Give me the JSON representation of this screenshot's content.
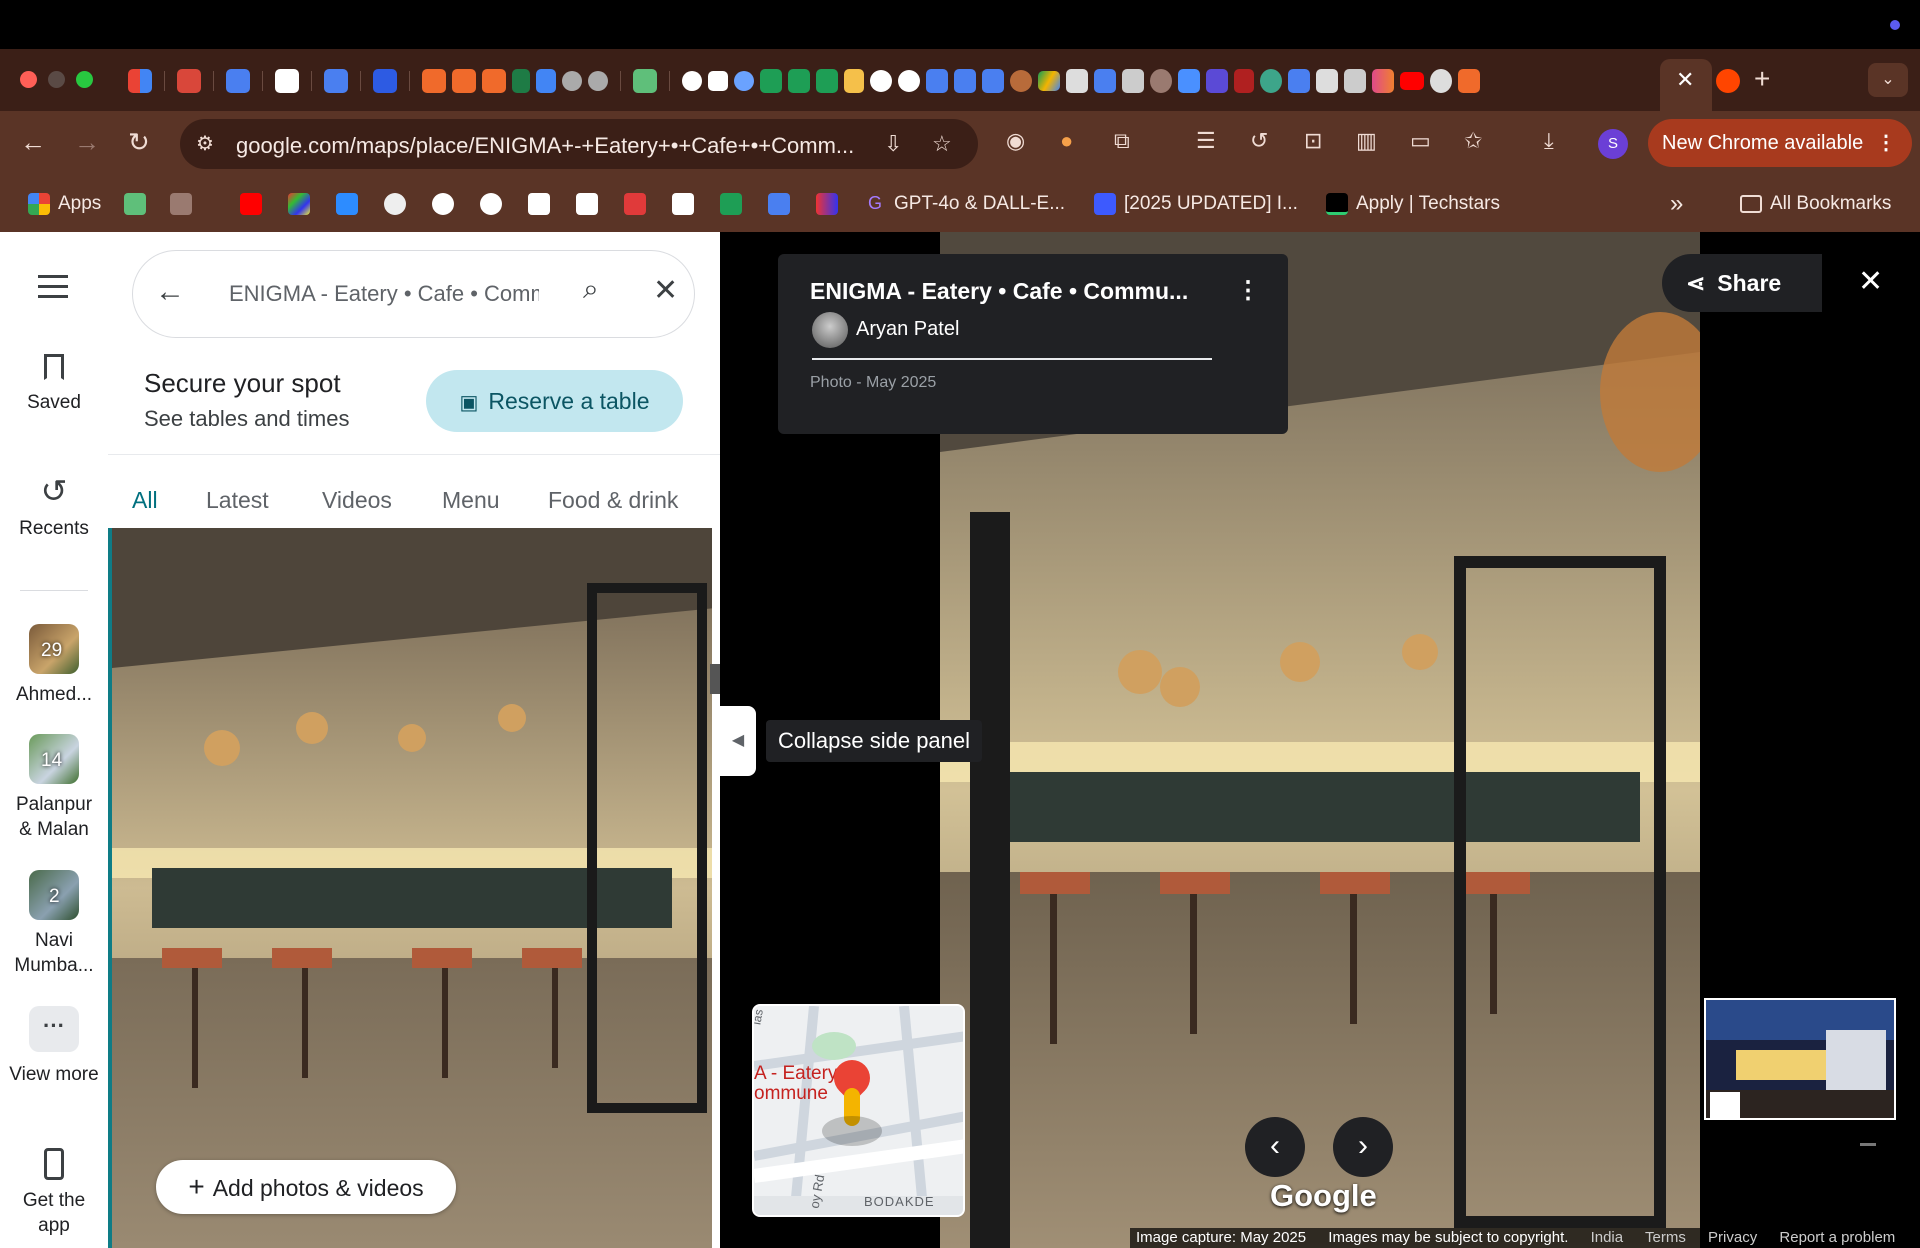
{
  "browser": {
    "url": "google.com/maps/place/ENIGMA+-+Eatery+•+Cafe+•+Comm...",
    "update_label": "New Chrome available",
    "profile_initial": "S",
    "accent_color": "#a83a1e",
    "frame_color": "#3b1f17",
    "toolbar_color": "#5a3426"
  },
  "bookmarks": {
    "apps": "Apps",
    "gpt": "GPT-4o & DALL-E...",
    "updated": "[2025 UPDATED] I...",
    "techstars": "Apply | Techstars",
    "overflow": "»",
    "all_bookmarks": "All Bookmarks"
  },
  "rail": {
    "saved": "Saved",
    "recents": "Recents",
    "recent_items": [
      {
        "count": "29",
        "label": "Ahmed..."
      },
      {
        "count": "14",
        "label": "Palanpur & Malan"
      },
      {
        "count": "2",
        "label": "Navi Mumba..."
      }
    ],
    "view_more": "View more",
    "get_app": "Get the app"
  },
  "panel": {
    "search_value": "ENIGMA - Eatery • Cafe • Commune",
    "promo_title": "Secure your spot",
    "promo_sub": "See tables and times",
    "reserve_label": "Reserve a table",
    "tabs": [
      "All",
      "Latest",
      "Videos",
      "Menu",
      "Food & drink"
    ],
    "active_tab": "All",
    "add_photos": "Add photos & videos"
  },
  "viewer": {
    "title": "ENIGMA - Eatery • Cafe • Commu...",
    "author": "Aryan Patel",
    "photo_date": "Photo - May 2025",
    "share": "Share",
    "collapse_tooltip": "Collapse side panel",
    "map_label_line1": "A - Eatery",
    "map_label_line2": "ommune",
    "map_street1": "BODAKDE",
    "map_street2": "oy Rd",
    "map_street3": "ias",
    "google_logo": "Google",
    "image_capture": "Image capture: May 2025",
    "copyright": "Images may be subject to copyright.",
    "region": "India",
    "terms": "Terms",
    "privacy": "Privacy",
    "report": "Report a problem"
  }
}
